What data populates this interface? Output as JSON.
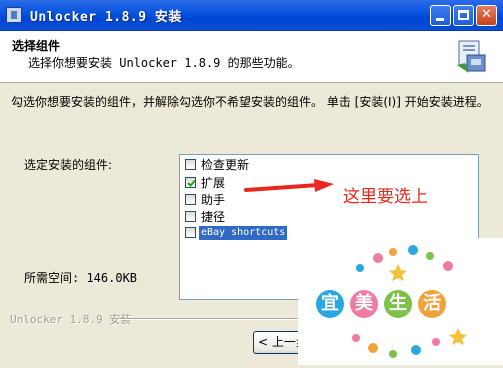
{
  "window": {
    "title": "Unlocker 1.8.9 安装",
    "buttons": {
      "minimize": "minimize",
      "maximize": "maximize",
      "close": "✕"
    }
  },
  "header": {
    "title": "选择组件",
    "subtitle": "选择你想要安装 Unlocker 1.8.9 的那些功能。"
  },
  "body": {
    "description": "勾选你想要安装的组件，并解除勾选你不希望安装的组件。 单击 [安装(I)] 开始安装进程。",
    "select_label": "选定安装的组件:",
    "space_required": "所需空间: 146.0KB",
    "components": [
      {
        "label": "检查更新",
        "checked": false,
        "selected": false
      },
      {
        "label": "扩展",
        "checked": true,
        "selected": false
      },
      {
        "label": "助手",
        "checked": false,
        "selected": false
      },
      {
        "label": "捷径",
        "checked": false,
        "selected": false
      },
      {
        "label": "eBay shortcuts",
        "checked": false,
        "selected": true
      }
    ]
  },
  "annotation": {
    "text": "这里要选上",
    "color": "#e8281e"
  },
  "footer": {
    "brand": "Unlocker 1.8.9 安装",
    "back_button": "< 上一步(P)"
  },
  "watermark": {
    "chars": [
      "宜",
      "美",
      "生",
      "活"
    ],
    "colors": [
      "#2aa7e0",
      "#f07aa0",
      "#7cc24a",
      "#f2a23a"
    ]
  }
}
